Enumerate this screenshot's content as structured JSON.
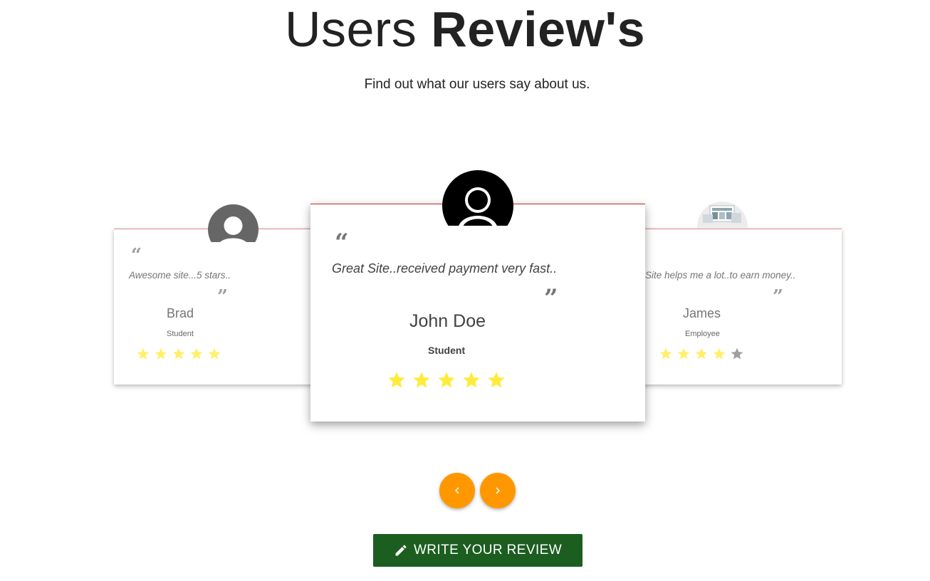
{
  "header": {
    "title_light": "Users",
    "title_bold": "Review's",
    "subtitle": "Find out what our users say about us."
  },
  "reviews": [
    {
      "position": "left",
      "text": "Awesome site...5 stars..",
      "name": "Brad",
      "role": "Student",
      "rating": 5,
      "avatar": "user-silhouette-gray"
    },
    {
      "position": "center",
      "text": "Great Site..received payment very fast..",
      "name": "John Doe",
      "role": "Student",
      "rating": 5,
      "avatar": "user-silhouette-black"
    },
    {
      "position": "right",
      "text": "Site helps me a lot..to earn money..",
      "name": "James",
      "role": "Employee",
      "rating": 4,
      "avatar": "website-screenshot"
    }
  ],
  "controls": {
    "prev_icon": "chevron-left-icon",
    "next_icon": "chevron-right-icon",
    "write_review_label": "WRITE YOUR REVIEW",
    "write_review_icon": "pencil-icon"
  },
  "colors": {
    "nav_button": "#ff9800",
    "write_button": "#1b5e20",
    "star_filled": "#ffeb3b",
    "star_empty": "#9e9e9e",
    "card_accent": "#c62828"
  }
}
